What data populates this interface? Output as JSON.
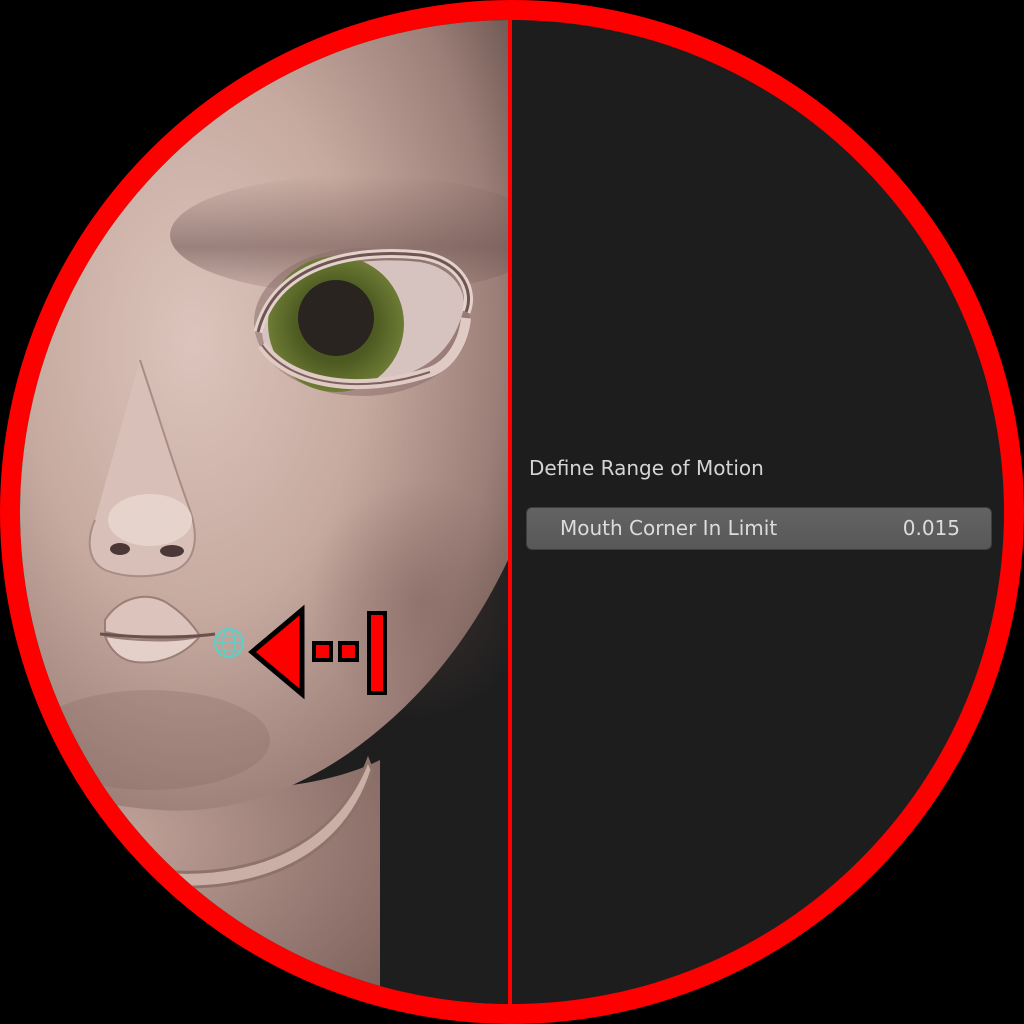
{
  "panel": {
    "section_title": "Define Range of Motion",
    "property": {
      "label": "Mouth Corner In Limit",
      "value": "0.015"
    }
  },
  "scene": {
    "selected_object": "mouth-corner-empty",
    "direction_indicator": "arrow-left-toward-limit"
  },
  "colors": {
    "frame": "#ff0000",
    "panel_background": "#1d1d1d",
    "skin": "#c7aca3",
    "iris": "#5d6b2c",
    "empty_marker": "#5ad0c8",
    "field_background": "#5d5d5d"
  }
}
